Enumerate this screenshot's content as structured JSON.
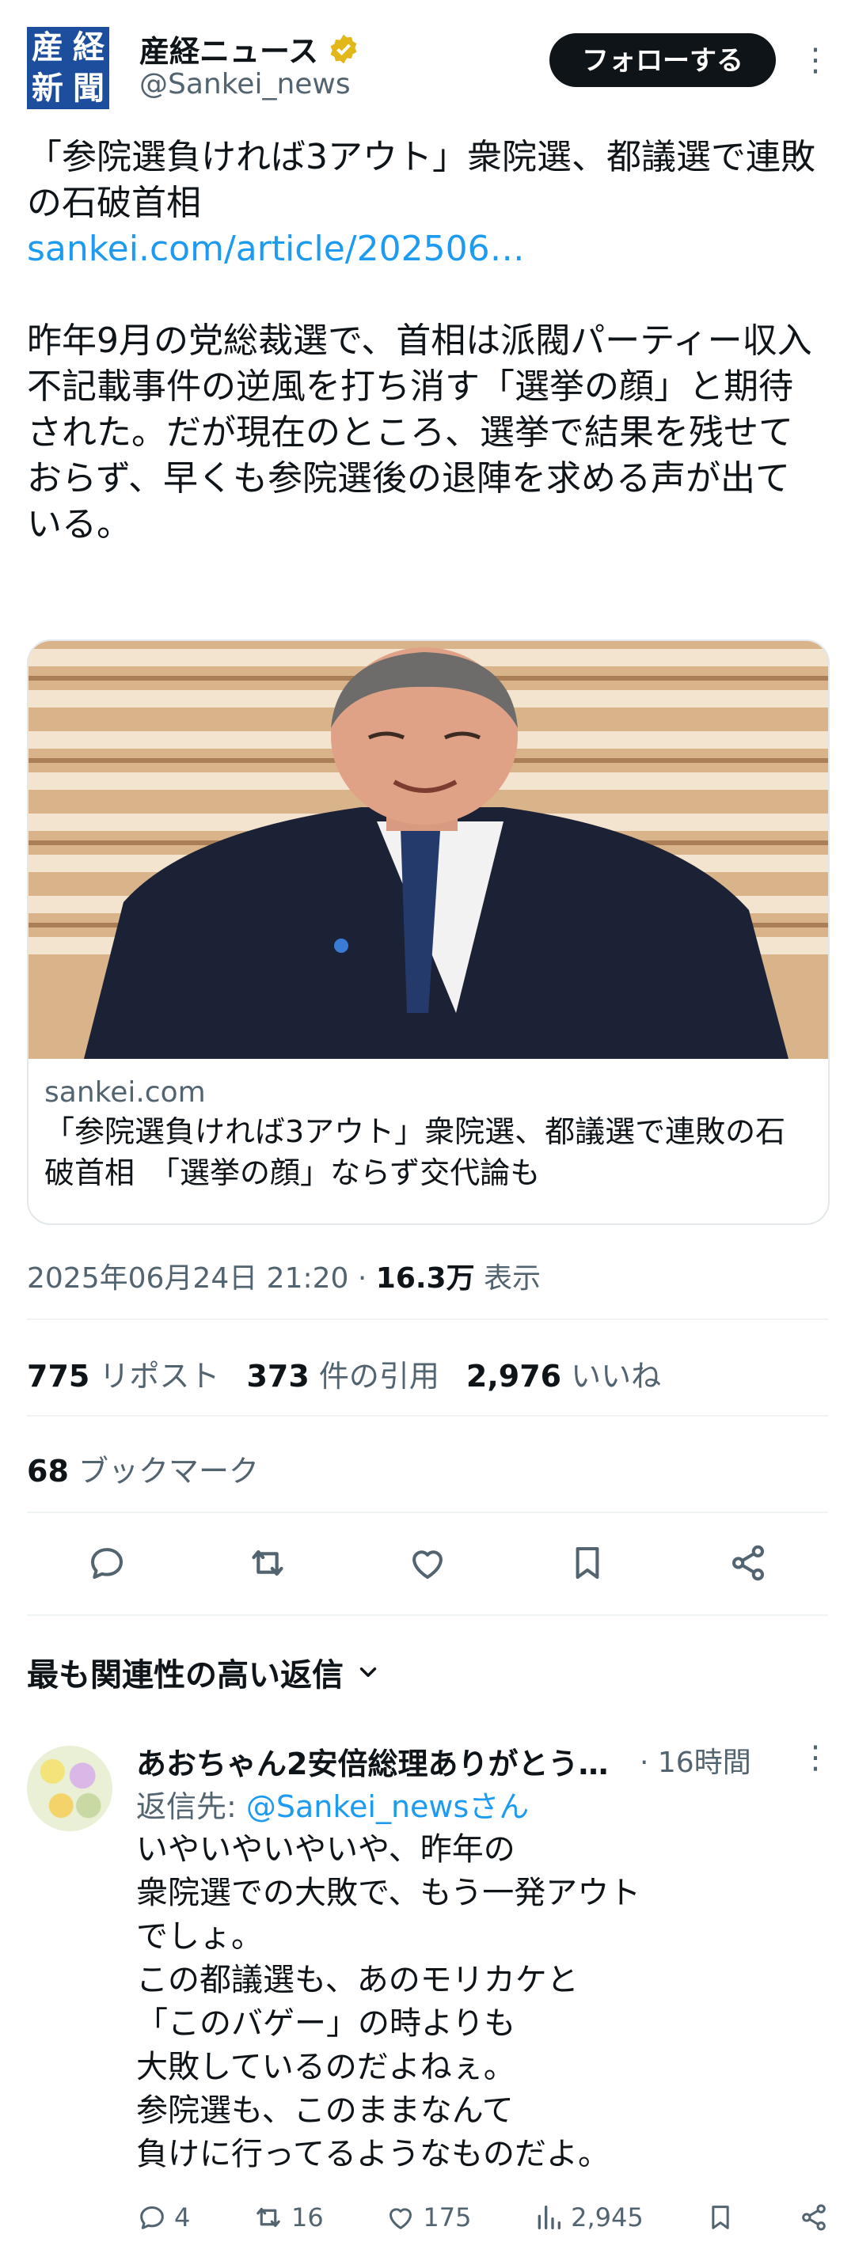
{
  "tweet": {
    "account_name": "産経ニュース",
    "handle": "@Sankei_news",
    "follow_label": "フォローする",
    "logo_chars": [
      "産",
      "経",
      "新",
      "聞"
    ],
    "text_main": "「参院選負ければ3アウト」衆院選、都議選で連敗の石破首相",
    "link": "sankei.com/article/202506…",
    "text_body": "昨年9月の党総裁選で、首相は派閥パーティー収入不記載事件の逆風を打ち消す「選挙の顔」と期待された。だが現在のところ、選挙で結果を残せておらず、早くも参院選後の退陣を求める声が出ている。",
    "card_domain": "sankei.com",
    "card_title": "「参院選負ければ3アウト」衆院選、都議選で連敗の石破首相　「選挙の顔」ならず交代論も",
    "date": "2025年06月24日 21:20 · ",
    "views": "16.3万",
    "views_label": " 表示",
    "reposts": "775",
    "reposts_label": "リポスト",
    "quotes": "373",
    "quotes_label": "件の引用",
    "likes": "2,976",
    "likes_label": "いいね",
    "bookmarks": "68",
    "bookmarks_label": "ブックマーク"
  },
  "replies_header": "最も関連性の高い返信",
  "reply": {
    "name": "あおちゃん2安倍総理ありがとう…",
    "time": "· 16時間",
    "reply_to_prefix": "返信先: ",
    "reply_to_handle": "@Sankei_newsさん",
    "text": "いやいやいやいや、昨年の\n衆院選での大敗で、もう一発アウト\nでしょ。\nこの都議選も、あのモリカケと\n「このバゲー」の時よりも\n大敗しているのだよねぇ。\n参院選も、このままなんて\n負けに行ってるようなものだよ。",
    "replies": "4",
    "retweets": "16",
    "likes": "175",
    "views": "2,945"
  },
  "colors": {
    "accent": "#1d9bf0",
    "secondary_text": "#536471",
    "verified": "#e2b719"
  }
}
